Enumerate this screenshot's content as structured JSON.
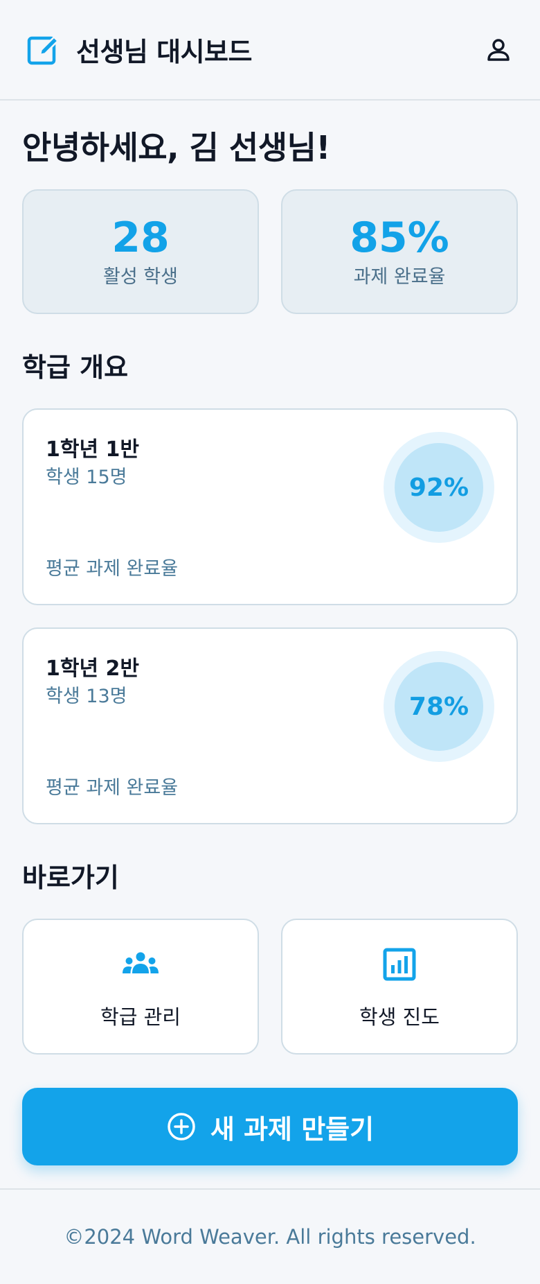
{
  "header": {
    "title": "선생님 대시보드",
    "brand_icon": "edit-square-icon",
    "profile_icon": "user-icon"
  },
  "greeting": "안녕하세요, 김 선생님!",
  "stats": [
    {
      "value": "28",
      "label": "활성 학생"
    },
    {
      "value": "85%",
      "label": "과제 완료율"
    }
  ],
  "overview": {
    "title": "학급 개요",
    "classes": [
      {
        "name": "1학년 1반",
        "students": "학생 15명",
        "avg_label": "평균 과제 완료율",
        "rate": "92%"
      },
      {
        "name": "1학년 2반",
        "students": "학생 13명",
        "avg_label": "평균 과제 완료율",
        "rate": "78%"
      }
    ]
  },
  "shortcuts": {
    "title": "바로가기",
    "items": [
      {
        "label": "학급 관리",
        "icon": "group-icon"
      },
      {
        "label": "학생 진도",
        "icon": "bar-chart-icon"
      }
    ]
  },
  "cta": {
    "label": "새 과제 만들기",
    "icon": "plus-circle-icon"
  },
  "footer": {
    "text": "©2024 Word Weaver. All rights reserved."
  },
  "colors": {
    "accent": "#13a3ea",
    "background": "#f5f7fa",
    "muted_text": "#4a7a99"
  }
}
